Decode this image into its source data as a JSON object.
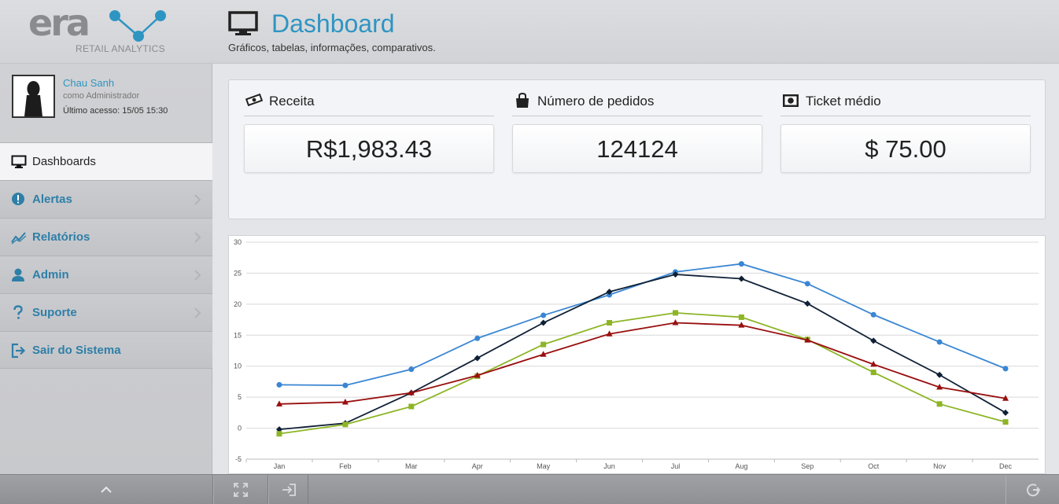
{
  "brand": {
    "logo_text": "era",
    "logo_subtitle": "RETAIL ANALYTICS"
  },
  "header": {
    "title": "Dashboard",
    "subtitle": "Gráficos, tabelas, informações, comparativos.",
    "icon": "monitor-icon"
  },
  "user": {
    "name": "Chau Sanh",
    "role": "como Administrador",
    "last_access": "Último acesso: 15/05 15:30"
  },
  "nav": {
    "items": [
      {
        "label": "Dashboards",
        "icon": "monitor-icon",
        "active": true
      },
      {
        "label": "Alertas",
        "icon": "alert-icon",
        "active": false
      },
      {
        "label": "Relatórios",
        "icon": "trend-icon",
        "active": false
      },
      {
        "label": "Admin",
        "icon": "user-icon",
        "active": false
      },
      {
        "label": "Suporte",
        "icon": "question-icon",
        "active": false
      },
      {
        "label": "Sair do Sistema",
        "icon": "exit-icon",
        "active": false
      }
    ]
  },
  "stats": [
    {
      "label": "Receita",
      "value": "R$1,983.43",
      "icon": "money-icon"
    },
    {
      "label": "Número de pedidos",
      "value": "124124",
      "icon": "bag-icon"
    },
    {
      "label": "Ticket médio",
      "value": "$ 75.00",
      "icon": "cash-icon"
    }
  ],
  "colors": {
    "accent": "#2e95c2",
    "series": [
      "#3a86d3",
      "#0f2036",
      "#8db526",
      "#990f0f"
    ]
  },
  "chart_data": {
    "type": "line",
    "categories": [
      "Jan",
      "Feb",
      "Mar",
      "Apr",
      "May",
      "Jun",
      "Jul",
      "Aug",
      "Sep",
      "Oct",
      "Nov",
      "Dec"
    ],
    "ylim": [
      -5,
      30
    ],
    "yticks": [
      -5,
      0,
      5,
      10,
      15,
      20,
      25,
      30
    ],
    "grid": true,
    "series": [
      {
        "marker": "circle",
        "values": [
          7.0,
          6.9,
          9.5,
          14.5,
          18.2,
          21.5,
          25.2,
          26.5,
          23.3,
          18.3,
          13.9,
          9.6
        ]
      },
      {
        "marker": "diamond",
        "values": [
          -0.2,
          0.8,
          5.7,
          11.3,
          17.0,
          22.0,
          24.8,
          24.1,
          20.1,
          14.1,
          8.6,
          2.5
        ]
      },
      {
        "marker": "square",
        "values": [
          -0.9,
          0.6,
          3.5,
          8.4,
          13.5,
          17.0,
          18.6,
          17.9,
          14.3,
          9.0,
          3.9,
          1.0
        ]
      },
      {
        "marker": "triangle",
        "values": [
          3.9,
          4.2,
          5.7,
          8.5,
          11.9,
          15.2,
          17.0,
          16.6,
          14.2,
          10.3,
          6.6,
          4.8
        ]
      }
    ]
  },
  "bottombar": {
    "buttons": [
      "chevron-up-icon",
      "fullscreen-icon",
      "login-icon",
      "power-icon"
    ]
  }
}
